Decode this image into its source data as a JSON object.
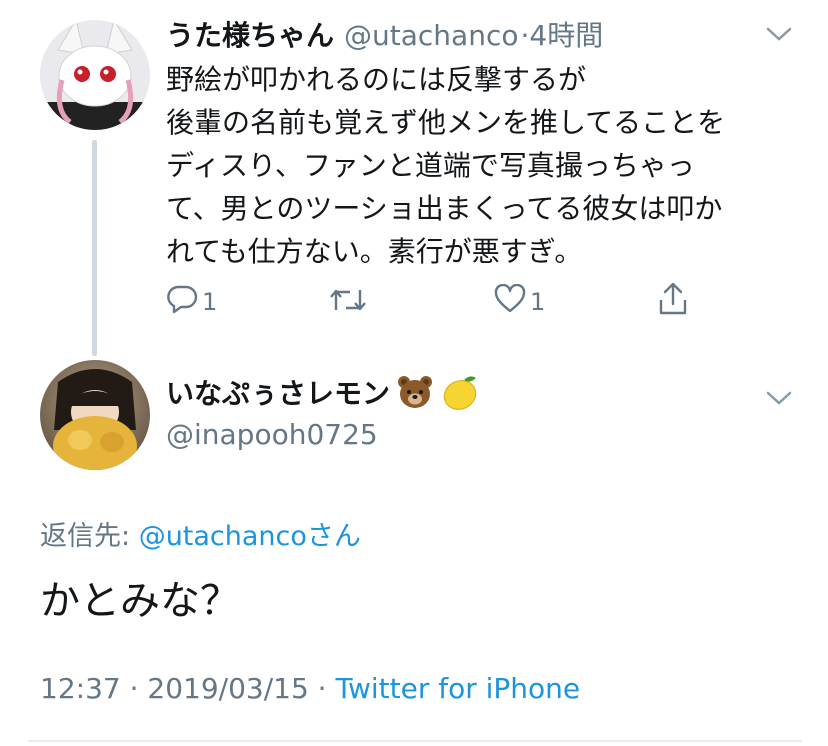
{
  "parent_tweet": {
    "name": "うた様ちゃん",
    "handle": "@utachanco",
    "separator": "·",
    "time": "4時間",
    "text_lines": [
      "野絵が叩かれるのには反撃するが",
      "後輩の名前も覚えず他メンを推してることを",
      "ディスり、ファンと道端で写真撮っちゃっ",
      "て、男とのツーショ出まくってる彼女は叩か",
      "れても仕方ない。素行が悪すぎ。"
    ],
    "actions": {
      "reply_count": "1",
      "retweet_count": "",
      "like_count": "1"
    }
  },
  "reply_tweet": {
    "name": "いなぷぅさレモン",
    "name_emojis": [
      "bear-emoji",
      "lemon-emoji"
    ],
    "handle": "@inapooh0725",
    "reply_to_label": "返信先: ",
    "reply_to_mention": "@utachanco",
    "reply_to_suffix": "さん",
    "text": "かとみな？",
    "timestamp": "12:37 · 2019/03/15 · ",
    "source": "Twitter for iPhone"
  },
  "colors": {
    "link": "#1b95e0",
    "secondary_text": "#657786",
    "primary_text": "#14171a",
    "thread_line": "#cfd9de"
  },
  "icons": [
    "reply-icon",
    "retweet-icon",
    "like-icon",
    "share-icon",
    "chevron-down-icon"
  ]
}
